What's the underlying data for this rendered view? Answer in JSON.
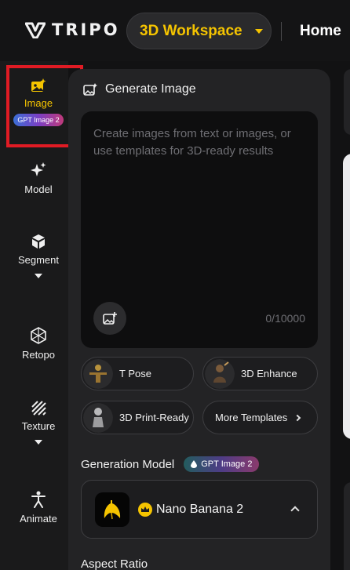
{
  "header": {
    "brand": "TRIPO",
    "workspace_label": "3D Workspace",
    "home_label": "Home"
  },
  "sidebar": {
    "items": [
      {
        "label": "Image",
        "badge": "GPT Image 2",
        "icon": "image-sparkle-icon",
        "active": true,
        "highlighted": true
      },
      {
        "label": "Model",
        "icon": "sparkles-icon"
      },
      {
        "label": "Segment",
        "icon": "cube-icon",
        "expandable": true
      },
      {
        "label": "Retopo",
        "icon": "mesh-icon"
      },
      {
        "label": "Texture",
        "icon": "texture-stripes-icon",
        "expandable": true
      },
      {
        "label": "Animate",
        "icon": "figure-icon"
      }
    ]
  },
  "panel": {
    "title": "Generate Image",
    "prompt_placeholder": "Create images from text or images, or use templates for 3D-ready results",
    "counter": "0/10000",
    "templates": [
      {
        "label": "T Pose",
        "icon": "t-pose-thumbnail"
      },
      {
        "label": "3D Enhance",
        "icon": "enhance-thumbnail"
      },
      {
        "label": "3D Print-Ready",
        "icon": "statue-thumbnail"
      },
      {
        "label": "More Templates",
        "icon": "chevron-right-icon"
      }
    ],
    "generation_model_label": "Generation Model",
    "generation_model_badge": "GPT Image 2",
    "selected_model": "Nano Banana 2",
    "aspect_ratio_label": "Aspect Ratio"
  },
  "colors": {
    "accent": "#f5c400",
    "highlight_border": "#e01b24",
    "background": "#121213",
    "panel": "#232325"
  }
}
